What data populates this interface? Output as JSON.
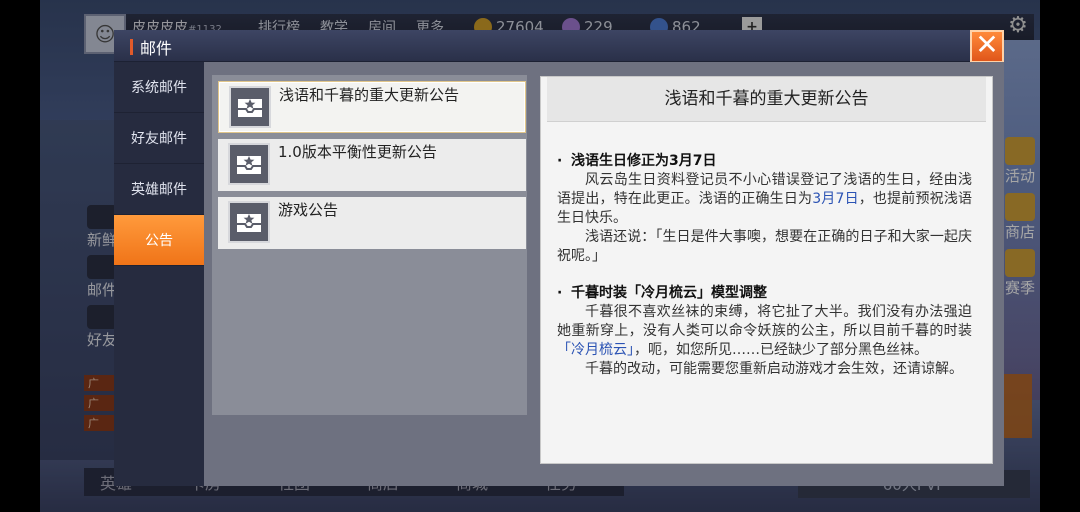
{
  "background": {
    "user": {
      "name": "皮皮皮皮",
      "id": "#1132"
    },
    "nav": [
      "排行榜",
      "教学",
      "房间",
      "更多"
    ],
    "resources": [
      {
        "icon": "gold-coin-icon",
        "value": "27604",
        "color": "#d4a22a"
      },
      {
        "icon": "gem-icon",
        "value": "229",
        "color": "#a57bd8"
      },
      {
        "icon": "ticket-icon",
        "value": "862",
        "color": "#4f7fd8"
      }
    ],
    "left_menu": [
      "新鲜",
      "邮件",
      "好友"
    ],
    "right_menu": [
      "活动",
      "商店",
      "赛季"
    ],
    "chat_rows": [
      "广",
      "广",
      "广"
    ],
    "bottom_tabs": [
      "英雄",
      "卡房",
      "社团",
      "商店",
      "商城",
      "任务"
    ],
    "pvp_label": "60人PVP"
  },
  "dialog": {
    "title": "邮件",
    "close_label": "✕",
    "tabs": [
      {
        "label": "系统邮件",
        "active": false
      },
      {
        "label": "好友邮件",
        "active": false
      },
      {
        "label": "英雄邮件",
        "active": false
      },
      {
        "label": "公告",
        "active": true
      }
    ],
    "mails": [
      {
        "title": "浅语和千暮的重大更新公告",
        "selected": true
      },
      {
        "title": "1.0版本平衡性更新公告",
        "selected": false
      },
      {
        "title": "游戏公告",
        "selected": false
      }
    ],
    "detail": {
      "title": "浅语和千暮的重大更新公告",
      "sections": [
        {
          "heading": "浅语生日修正为3月7日",
          "p1_a": "风云岛生日资料登记员不小心错误登记了浅语的生日，经由浅语提出，特在此更正。浅语的正确生日为",
          "p1_hl": "3月7日",
          "p1_b": "，也提前预祝浅语生日快乐。",
          "p2": "浅语还说：「生日是件大事噢，想要在正确的日子和大家一起庆祝呢。」"
        },
        {
          "heading": "千暮时装「冷月梳云」模型调整",
          "p1_a": "千暮很不喜欢丝袜的束缚，将它扯了大半。我们没有办法强迫她重新穿上，没有人类可以命令妖族的公主，所以目前千暮的时装",
          "p1_hl": "「冷月梳云」",
          "p1_b": "，呃，如您所见……已经缺少了部分黑色丝袜。",
          "p2": "千暮的改动，可能需要您重新启动游戏才会生效，还请谅解。"
        }
      ]
    }
  }
}
